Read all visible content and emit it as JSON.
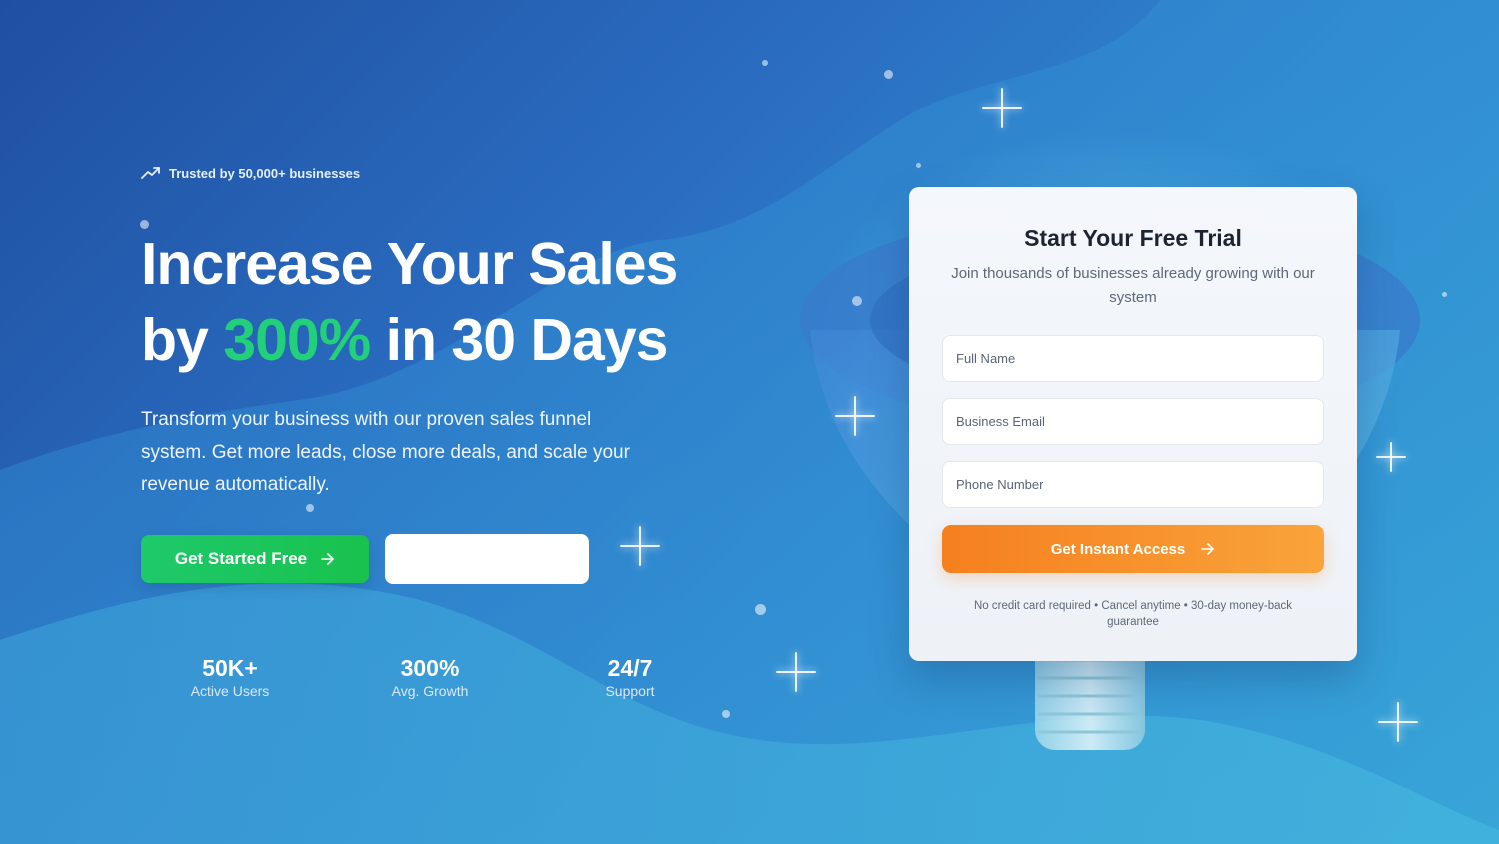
{
  "hero": {
    "trusted_text": "Trusted by 50,000+ businesses",
    "headline_line1": "Increase Your Sales",
    "headline_by": "by",
    "headline_accent": "300%",
    "headline_rest": "in 30 Days",
    "subtext": "Transform your business with our proven sales funnel system. Get more leads, close more deals, and scale your revenue automatically.",
    "primary_cta_label": "Get Started Free",
    "secondary_cta_label": ""
  },
  "stats": [
    {
      "value": "50K+",
      "label": "Active Users"
    },
    {
      "value": "300%",
      "label": "Avg. Growth"
    },
    {
      "value": "24/7",
      "label": "Support"
    }
  ],
  "form": {
    "title": "Start Your Free Trial",
    "subtitle": "Join thousands of businesses already growing with our system",
    "full_name_placeholder": "Full Name",
    "email_placeholder": "Business Email",
    "phone_placeholder": "Phone Number",
    "submit_label": "Get Instant Access",
    "fineprint": "No credit card required • Cancel anytime • 30-day money-back guarantee"
  },
  "colors": {
    "accent_green": "#22d07a",
    "cta_orange": "#f67f1f",
    "bg_blue": "#2a6cc0"
  },
  "icons": {
    "trend": "trending-up-icon",
    "arrow": "arrow-right-icon"
  }
}
